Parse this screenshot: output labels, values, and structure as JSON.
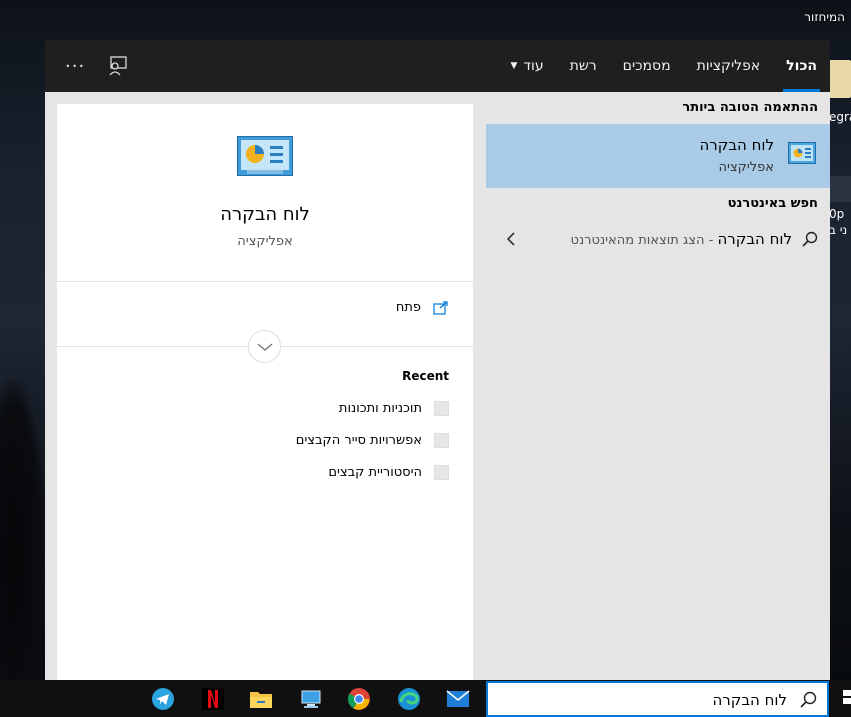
{
  "desktop": {
    "top_icon_label": "המיחזור",
    "right_icon1_label": "egra",
    "right_icon2_label": "0p",
    "right_icon2_label2": "ני ב"
  },
  "tabs": [
    {
      "label": "הכול",
      "active": true
    },
    {
      "label": "אפליקציות",
      "active": false
    },
    {
      "label": "מסמכים",
      "active": false
    },
    {
      "label": "רשת",
      "active": false
    },
    {
      "label": "עוד",
      "active": false
    }
  ],
  "topbar": {
    "more_icon": "ellipsis-icon",
    "feedback_icon": "feedback-icon"
  },
  "results": {
    "best_match_title": "ההתאמה הטובה ביותר",
    "best_match": {
      "name": "לוח הבקרה",
      "type": "אפליקציה"
    },
    "web_title": "חפש באינטרנט",
    "web_query": "לוח הבקרה",
    "web_hint": " - הצג תוצאות מהאינטרנט"
  },
  "preview": {
    "name": "לוח הבקרה",
    "type": "אפליקציה",
    "open_label": "פתח",
    "recent_title": "Recent",
    "recent_items": [
      "תוכניות ותכונות",
      "אפשרויות סייר הקבצים",
      "היסטוריית קבצים"
    ]
  },
  "search": {
    "value": "לוח הבקרה"
  },
  "taskbar": {
    "icons": [
      "telegram-icon",
      "netflix-icon",
      "file-explorer-icon",
      "this-pc-icon",
      "chrome-icon",
      "edge-icon",
      "mail-icon"
    ]
  },
  "colors": {
    "accent": "#0078d7",
    "selected_bg": "#a9cbe8",
    "topbar_bg": "#1f1f1f",
    "pane_bg": "#e5e5e5"
  }
}
